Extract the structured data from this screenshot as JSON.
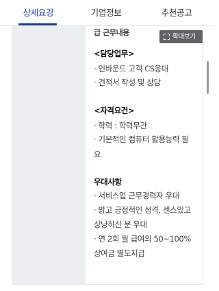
{
  "tabs": [
    {
      "label": "상세요강",
      "active": true
    },
    {
      "label": "기업정보",
      "active": false
    },
    {
      "label": "추천공고",
      "active": false
    }
  ],
  "colors": {
    "accent": "#1a3e9e",
    "zoom_button_bg": "#5f6368",
    "side_bg": "#eceff2"
  },
  "zoom_button": {
    "label": "확대보기",
    "icon": "expand-icon"
  },
  "detail": {
    "cut_text": "급 근무내용",
    "duties_heading": "<담당업무>",
    "duties": [
      "· 인바운드 고객 CS응대",
      "· 견적서 작성 및 상담"
    ],
    "req_heading": "<자격요건>",
    "requirements": [
      "· 학력 : 학력무관",
      "· 기본적인 컴퓨터 활용능력 필",
      "요"
    ],
    "pref_heading": "우대사항",
    "preferences": [
      "· 서비스업 근무경력자 우대",
      "· 밝고 긍정적인 성격, 센스있고",
      "상냥하신 분 우대",
      "· 연 2회 월 급여의 50~100%",
      "상여금 별도지급"
    ]
  }
}
